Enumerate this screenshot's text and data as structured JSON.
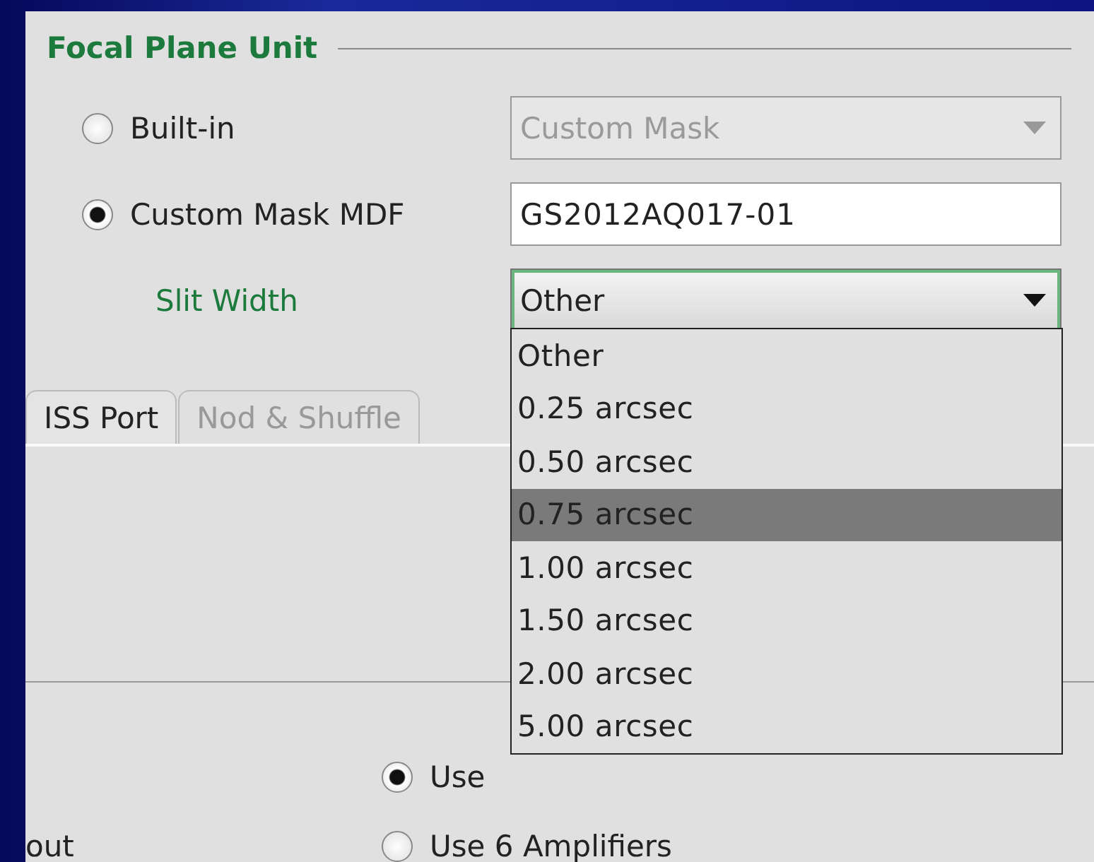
{
  "section": {
    "title": "Focal Plane Unit"
  },
  "fpu_options": [
    {
      "label": "Built-in",
      "selected": false,
      "kind": "combo",
      "value": "Custom Mask",
      "disabled": true
    },
    {
      "label": "Custom Mask MDF",
      "selected": true,
      "kind": "text",
      "value": "GS2012AQ017-01",
      "disabled": false
    }
  ],
  "slit_width": {
    "label": "Slit Width",
    "value": "Other",
    "focused": true
  },
  "slit_width_menu": [
    {
      "label": "Other",
      "selected": false
    },
    {
      "label": "0.25 arcsec",
      "selected": false
    },
    {
      "label": "0.50 arcsec",
      "selected": false
    },
    {
      "label": "0.75 arcsec",
      "selected": true
    },
    {
      "label": "1.00 arcsec",
      "selected": false
    },
    {
      "label": "1.50 arcsec",
      "selected": false
    },
    {
      "label": "2.00 arcsec",
      "selected": false
    },
    {
      "label": "5.00 arcsec",
      "selected": false
    }
  ],
  "tabs": [
    {
      "label": "ISS Port",
      "selected": true
    },
    {
      "label": "Nod & Shuffle",
      "selected": false
    }
  ],
  "readout_label": "out",
  "amplifiers": [
    {
      "label": "Use",
      "selected": true
    },
    {
      "label": "Use 6 Amplifiers",
      "selected": false
    }
  ]
}
